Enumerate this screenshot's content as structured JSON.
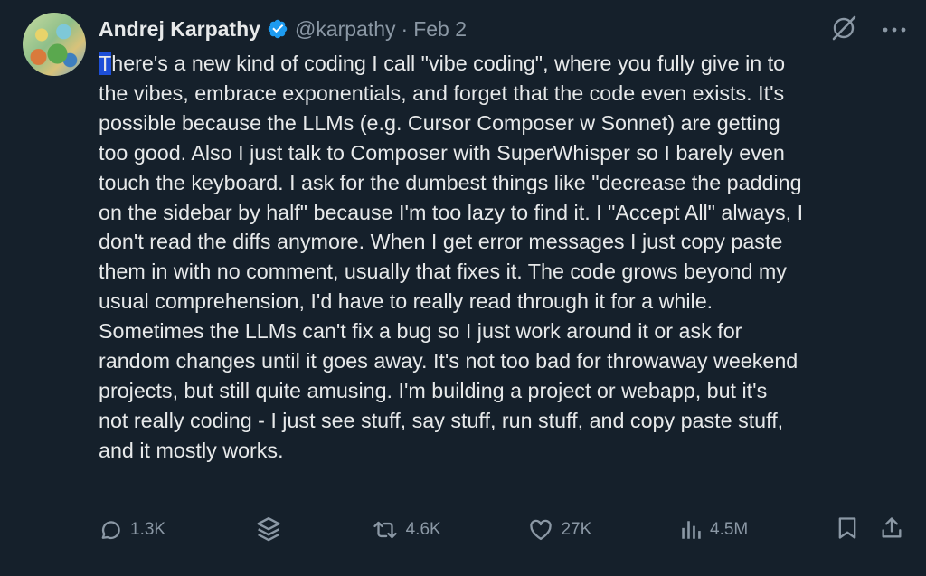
{
  "author": {
    "name": "Andrej Karpathy",
    "handle": "@karpathy",
    "separator": "·",
    "date": "Feb 2"
  },
  "tweet": {
    "first_char": "T",
    "lines": [
      "here's a new kind of coding I call \"vibe coding\", where you fully give in to",
      "the vibes, embrace exponentials, and forget that the code even exists. It's",
      "possible because the LLMs (e.g. Cursor Composer w Sonnet) are getting",
      "too good. Also I just talk to Composer with SuperWhisper so I barely even",
      "touch the keyboard. I ask for the dumbest things like \"decrease the padding",
      "on the sidebar by half\" because I'm too lazy to find it. I \"Accept All\" always, I",
      "don't read the diffs anymore. When I get error messages I just copy paste",
      "them in with no comment, usually that fixes it. The code grows beyond my",
      "usual comprehension, I'd have to really read through it for a while.",
      "Sometimes the LLMs can't fix a bug so I just work around it or ask for",
      "random changes until it goes away. It's not too bad for throwaway weekend",
      "projects, but still quite amusing. I'm building a project or webapp, but it's",
      "not really coding - I just see stuff, say stuff, run stuff, and copy paste stuff,",
      "and it mostly works."
    ]
  },
  "stats": {
    "replies": "1.3K",
    "reposts": "4.6K",
    "likes": "27K",
    "views": "4.5M"
  },
  "icons": {
    "verified": "verified-badge-icon",
    "grok": "grok-icon",
    "more": "more-icon",
    "reply": "reply-icon",
    "layers": "layers-icon",
    "repost": "repost-icon",
    "like": "heart-icon",
    "views": "views-icon",
    "bookmark": "bookmark-icon",
    "share": "share-icon"
  },
  "colors": {
    "background": "#15202b",
    "text": "#e7e9ea",
    "muted": "#8b98a5",
    "verified": "#1d9bf0",
    "selection": "#1d4fd8"
  }
}
